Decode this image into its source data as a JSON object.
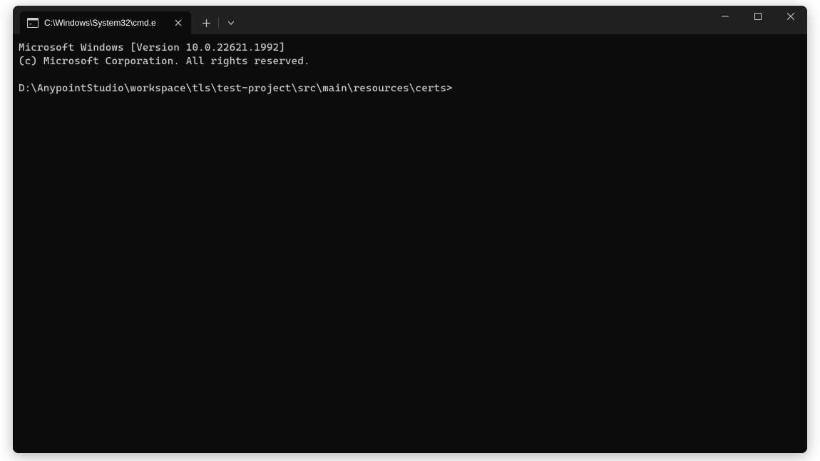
{
  "tab": {
    "title": "C:\\Windows\\System32\\cmd.e"
  },
  "terminal": {
    "line1": "Microsoft Windows [Version 10.0.22621.1992]",
    "line2": "(c) Microsoft Corporation. All rights reserved.",
    "blank": "",
    "prompt": "D:\\AnypointStudio\\workspace\\tls\\test-project\\src\\main\\resources\\certs>"
  }
}
